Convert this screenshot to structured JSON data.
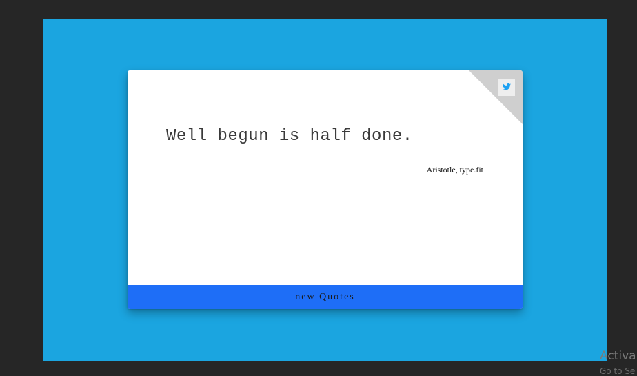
{
  "quote_card": {
    "quote_text": "Well begun is half done.",
    "author": "Aristotle, type.fit",
    "new_quote_label": "new Quotes",
    "tweet_icon": "twitter-icon"
  },
  "watermark": {
    "title": "Activa",
    "subtitle": "Go to Se"
  },
  "colors": {
    "page_background": "#1ba5e0",
    "button_background": "#1e6ef7",
    "twitter_blue": "#1da1f2",
    "fold": "#cfcfcf"
  }
}
